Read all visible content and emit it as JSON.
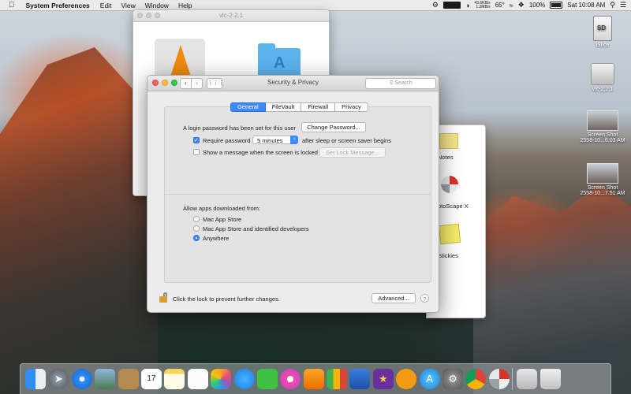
{
  "menubar": {
    "apple": "",
    "app_name": "System Preferences",
    "items": [
      "Edit",
      "View",
      "Window",
      "Help"
    ],
    "net_up": "43.6KB/s",
    "net_down": "1.2MB/s",
    "temperature": "65°",
    "battery": "100%",
    "clock": "Sat 10:08 AM"
  },
  "desktop_icons": {
    "islice": "iSlice",
    "vlc_drive": "vlc-2.2.1",
    "shot1_line1": "Screen Shot",
    "shot1_line2": "2558-10...6.03 AM",
    "shot2_line1": "Screen Shot",
    "shot2_line2": "2558-10...7.51 AM"
  },
  "vlc_window": {
    "title": "vlc-2.2.1"
  },
  "apps_window": {
    "notes": "Notes",
    "photoscape": "otoScape X",
    "stickies": "Stickies"
  },
  "security_window": {
    "title": "Security & Privacy",
    "search_placeholder": "Search",
    "tabs": [
      {
        "label": "General",
        "active": true
      },
      {
        "label": "FileVault",
        "active": false
      },
      {
        "label": "Firewall",
        "active": false
      },
      {
        "label": "Privacy",
        "active": false
      }
    ],
    "login_password_text": "A login password has been set for this user",
    "change_password_label": "Change Password...",
    "require_password_label": "Require password",
    "require_password_checked": true,
    "require_delay_value": "5 minutes",
    "after_sleep_text": "after sleep or screen saver begins",
    "show_message_label": "Show a message when the screen is locked",
    "show_message_checked": false,
    "set_lock_message_label": "Set Lock Message...",
    "allow_apps_heading": "Allow apps downloaded from:",
    "gatekeeper_options": [
      {
        "label": "Mac App Store",
        "selected": false
      },
      {
        "label": "Mac App Store and identified developers",
        "selected": false
      },
      {
        "label": "Anywhere",
        "selected": true
      }
    ],
    "lock_text": "Click the lock to prevent further changes.",
    "advanced_label": "Advanced...",
    "help_label": "?"
  },
  "colors": {
    "accent": "#3d8af7",
    "close": "#fc605c",
    "minimize": "#fdbc40",
    "zoom": "#34c84a"
  },
  "dock": {
    "icons": [
      "finder-icon",
      "launchpad-icon",
      "safari-icon",
      "preview-icon",
      "contacts-icon",
      "calendar-icon",
      "notes-icon",
      "reminders-icon",
      "photos-icon",
      "messages-icon",
      "facetime-icon",
      "itunes-icon",
      "ibooks-icon",
      "numbers-icon",
      "keynote-icon",
      "imovie-icon",
      "ibooks-store-icon",
      "app-store-icon",
      "system-preferences-icon",
      "chrome-icon",
      "photoscape-icon",
      "downloads-icon",
      "trash-icon"
    ],
    "calendar_day": "17"
  }
}
